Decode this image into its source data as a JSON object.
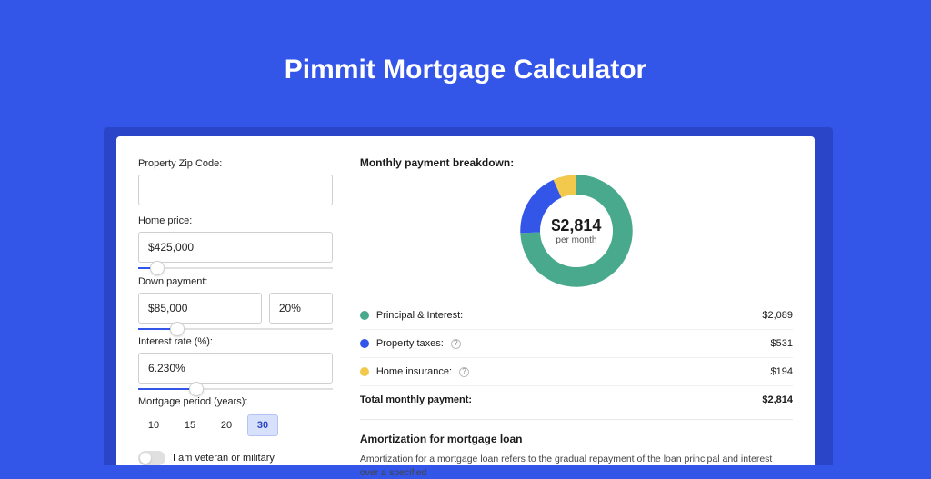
{
  "header": {
    "title": "Pimmit Mortgage Calculator"
  },
  "colors": {
    "accent": "#3355E8",
    "principal": "#49A98D",
    "taxes": "#3355E8",
    "insurance": "#F2C94C"
  },
  "form": {
    "zip": {
      "label": "Property Zip Code:",
      "value": ""
    },
    "home_price": {
      "label": "Home price:",
      "value": "$425,000",
      "slider_pct": 10
    },
    "down_payment": {
      "label": "Down payment:",
      "value": "$85,000",
      "pct": "20%",
      "slider_pct": 20
    },
    "interest": {
      "label": "Interest rate (%):",
      "value": "6.230%",
      "slider_pct": 30
    },
    "period": {
      "label": "Mortgage period (years):",
      "options": [
        "10",
        "15",
        "20",
        "30"
      ],
      "selected": "30"
    },
    "veteran": {
      "label": "I am veteran or military"
    }
  },
  "results": {
    "title": "Monthly payment breakdown:",
    "center_amount": "$2,814",
    "center_sub": "per month",
    "lines": [
      {
        "name": "Principal & Interest:",
        "value": "$2,089",
        "help": false,
        "color": "#49A98D"
      },
      {
        "name": "Property taxes:",
        "value": "$531",
        "help": true,
        "color": "#3355E8"
      },
      {
        "name": "Home insurance:",
        "value": "$194",
        "help": true,
        "color": "#F2C94C"
      }
    ],
    "total": {
      "name": "Total monthly payment:",
      "value": "$2,814"
    }
  },
  "amort": {
    "title": "Amortization for mortgage loan",
    "body": "Amortization for a mortgage loan refers to the gradual repayment of the loan principal and interest over a specified"
  },
  "chart_data": {
    "type": "pie",
    "title": "Monthly payment breakdown",
    "series": [
      {
        "name": "Principal & Interest",
        "value": 2089,
        "color": "#49A98D"
      },
      {
        "name": "Property taxes",
        "value": 531,
        "color": "#3355E8"
      },
      {
        "name": "Home insurance",
        "value": 194,
        "color": "#F2C94C"
      }
    ],
    "total": 2814,
    "center_label": "$2,814 per month"
  }
}
